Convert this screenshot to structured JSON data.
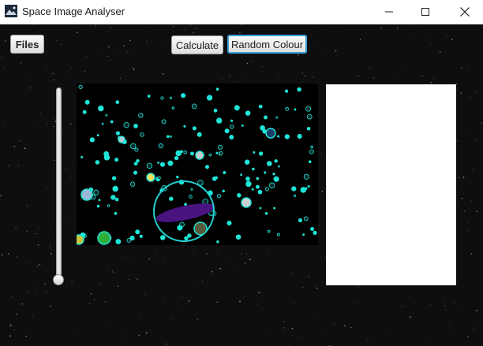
{
  "window": {
    "title": "Space Image Analyser",
    "app_icon": "galaxy-image-icon",
    "controls": [
      "minimize-icon",
      "maximize-icon",
      "close-icon"
    ]
  },
  "toolbar": {
    "files_label": "Files",
    "calculate_label": "Calculate",
    "random_colour_label": "Random Colour"
  },
  "slider": {
    "orientation": "vertical",
    "value": 0.0
  },
  "colors": {
    "star_outline": "#1ee6d8",
    "selection_ring": "#22d3d3",
    "cluster_fill": "#4a1480",
    "focus_border": "#39a0d8"
  }
}
